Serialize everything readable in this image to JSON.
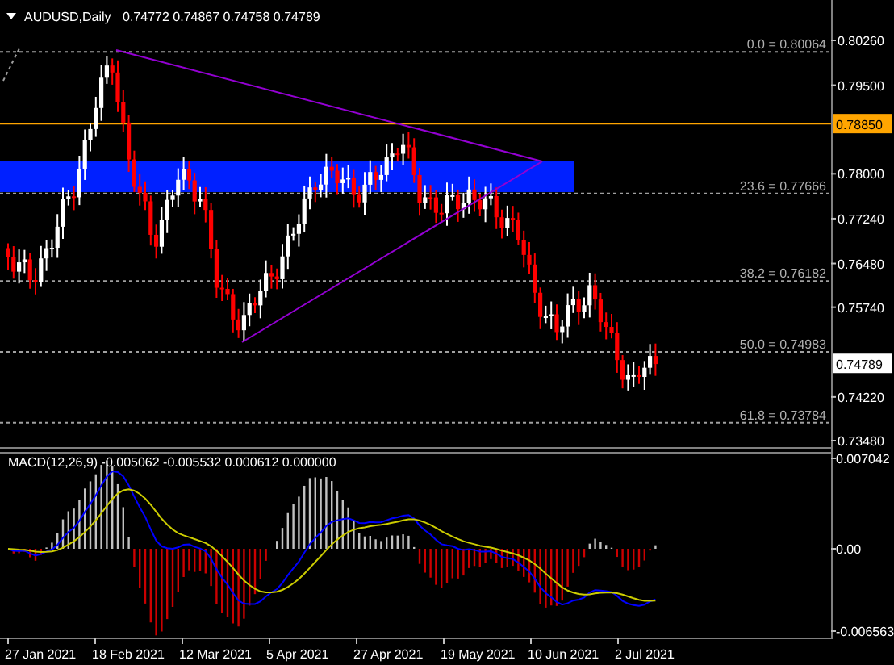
{
  "header": {
    "symbol": "AUDUSD,Daily",
    "ohlc": "0.74772 0.74867 0.74758 0.74789"
  },
  "price_axis": [
    "0.80260",
    "0.79500",
    "0.78000",
    "0.77240",
    "0.76480",
    "0.75740",
    "0.74220",
    "0.73480"
  ],
  "price_tags": [
    {
      "kind": "line",
      "text": "0.78850",
      "color": "#ffa500"
    },
    {
      "kind": "bid",
      "text": "0.74789",
      "color": "#ffffff"
    }
  ],
  "fib_levels": [
    "0.0 = 0.80064",
    "23.6 = 0.77666",
    "38.2 = 0.76182",
    "50.0 = 0.74983",
    "61.8 = 0.73784"
  ],
  "macd": {
    "label": "MACD(12,26,9) -0.005062 -0.005532 0.000612 0.000000",
    "axis": [
      "0.007042",
      "0.00",
      "-0.006563"
    ]
  },
  "date_axis": [
    "27 Jan 2021",
    "18 Feb 2021",
    "12 Mar 2021",
    "5 Apr 2021",
    "27 Apr 2021",
    "19 May 2021",
    "10 Jun 2021",
    "2 Jul 2021"
  ]
}
